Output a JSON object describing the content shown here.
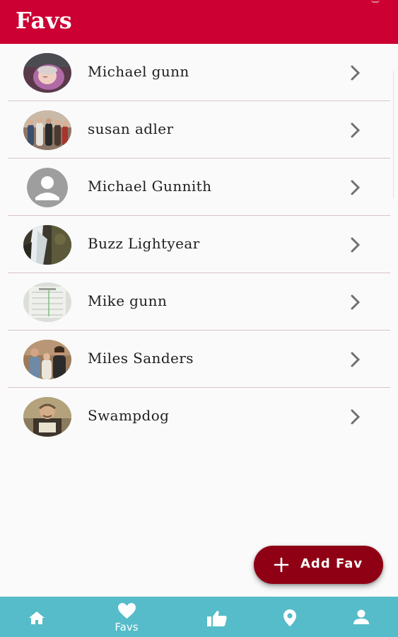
{
  "app": {
    "title": "Favs",
    "accent_color": "#cc0033",
    "nav_color": "#56bcc9",
    "fab_color": "#8f0015"
  },
  "favorites": [
    {
      "name": "Michael gunn",
      "avatar": "baby-photo"
    },
    {
      "name": "susan adler",
      "avatar": "group-photo"
    },
    {
      "name": "Michael Gunnith",
      "avatar": "default-person-icon"
    },
    {
      "name": "Buzz Lightyear",
      "avatar": "waterfall-photo"
    },
    {
      "name": "Mike gunn",
      "avatar": "document-photo"
    },
    {
      "name": "Miles Sanders",
      "avatar": "family-photo"
    },
    {
      "name": "Swampdog",
      "avatar": "man-photo"
    }
  ],
  "fab": {
    "label": "Add Fav",
    "icon": "plus-icon"
  },
  "bottom_nav": [
    {
      "icon": "home-icon",
      "label": ""
    },
    {
      "icon": "heart-icon",
      "label": "Favs",
      "active": true
    },
    {
      "icon": "thumbs-up-icon",
      "label": ""
    },
    {
      "icon": "location-pin-icon",
      "label": ""
    },
    {
      "icon": "person-icon",
      "label": ""
    }
  ]
}
